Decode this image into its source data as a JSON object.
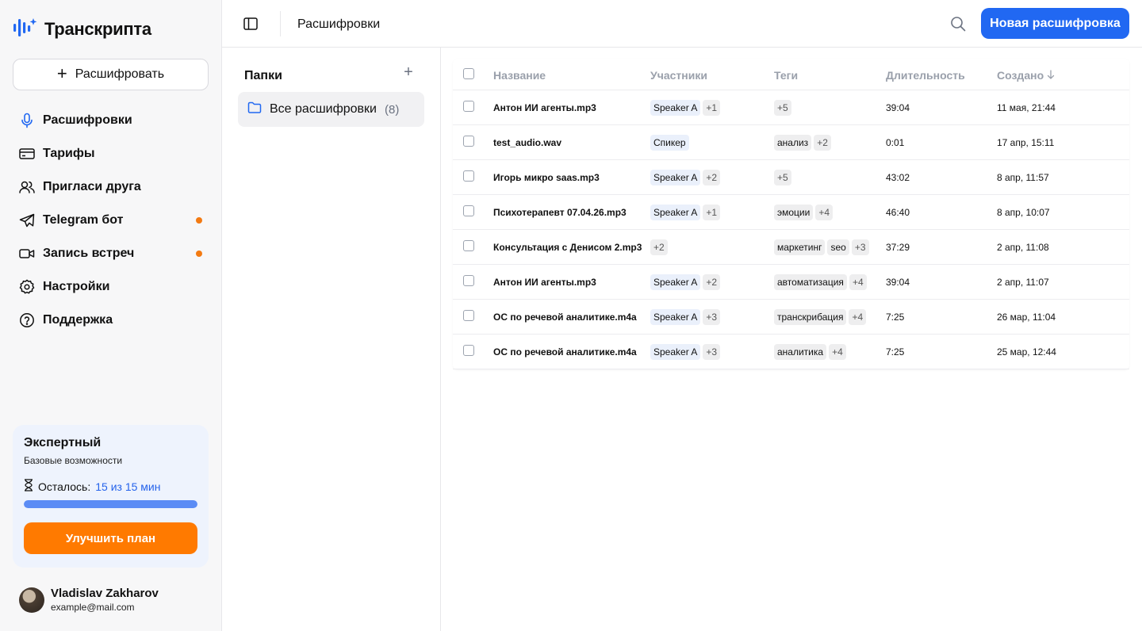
{
  "app": {
    "name": "Транскрипта",
    "colors": {
      "accent": "#2168f2",
      "orange": "#ff7a00",
      "dot": "#f37a12"
    }
  },
  "sidebar": {
    "transcribe_label": "Расшифровать",
    "nav": [
      {
        "label": "Расшифровки",
        "icon": "microphone-icon",
        "dot": false
      },
      {
        "label": "Тарифы",
        "icon": "credit-card-icon",
        "dot": false
      },
      {
        "label": "Пригласи друга",
        "icon": "users-icon",
        "dot": false
      },
      {
        "label": "Telegram бот",
        "icon": "telegram-icon",
        "dot": true
      },
      {
        "label": "Запись встреч",
        "icon": "video-camera-icon",
        "dot": true
      },
      {
        "label": "Настройки",
        "icon": "settings-icon",
        "dot": false
      },
      {
        "label": "Поддержка",
        "icon": "help-circle-icon",
        "dot": false
      }
    ],
    "plan": {
      "name": "Экспертный",
      "subtitle": "Базовые возможности",
      "remaining_label": "Осталось:",
      "remaining_value": "15 из 15 мин",
      "remaining_fraction": 1.0,
      "upgrade_label": "Улучшить план"
    },
    "user": {
      "name": "Vladislav Zakharov",
      "email": "example@mail.com"
    }
  },
  "topbar": {
    "title": "Расшифровки",
    "new_button": "Новая расшифровка"
  },
  "folders": {
    "title": "Папки",
    "items": [
      {
        "label": "Все расшифровки",
        "count": "(8)"
      }
    ]
  },
  "table": {
    "columns": {
      "name": "Название",
      "participants": "Участники",
      "tags": "Теги",
      "duration": "Длительность",
      "created": "Создано"
    },
    "rows": [
      {
        "name": "Антон ИИ агенты.mp3",
        "participants": [
          "Speaker A"
        ],
        "participants_more": "+1",
        "tags": [],
        "tags_more": "+5",
        "duration": "39:04",
        "created": "11 мая, 21:44"
      },
      {
        "name": "test_audio.wav",
        "participants": [
          "Спикер"
        ],
        "participants_more": "",
        "tags": [
          "анализ"
        ],
        "tags_more": "+2",
        "duration": "0:01",
        "created": "17 апр, 15:11"
      },
      {
        "name": "Игорь микро saas.mp3",
        "participants": [
          "Speaker A"
        ],
        "participants_more": "+2",
        "tags": [],
        "tags_more": "+5",
        "duration": "43:02",
        "created": "8 апр, 11:57"
      },
      {
        "name": "Психотерапевт 07.04.26.mp3",
        "participants": [
          "Speaker A"
        ],
        "participants_more": "+1",
        "tags": [
          "эмоции"
        ],
        "tags_more": "+4",
        "duration": "46:40",
        "created": "8 апр, 10:07"
      },
      {
        "name": "Консультация с Денисом 2.mp3",
        "participants": [],
        "participants_more": "+2",
        "tags": [
          "маркетинг",
          "seo"
        ],
        "tags_more": "+3",
        "duration": "37:29",
        "created": "2 апр, 11:08"
      },
      {
        "name": "Антон ИИ агенты.mp3",
        "participants": [
          "Speaker A"
        ],
        "participants_more": "+2",
        "tags": [
          "автоматизация"
        ],
        "tags_more": "+4",
        "duration": "39:04",
        "created": "2 апр, 11:07"
      },
      {
        "name": "ОС по речевой аналитике.m4a",
        "participants": [
          "Speaker A"
        ],
        "participants_more": "+3",
        "tags": [
          "транскрибация"
        ],
        "tags_more": "+4",
        "duration": "7:25",
        "created": "26 мар, 11:04"
      },
      {
        "name": "ОС по речевой аналитике.m4a",
        "participants": [
          "Speaker A"
        ],
        "participants_more": "+3",
        "tags": [
          "аналитика"
        ],
        "tags_more": "+4",
        "duration": "7:25",
        "created": "25 мар, 12:44"
      }
    ]
  }
}
